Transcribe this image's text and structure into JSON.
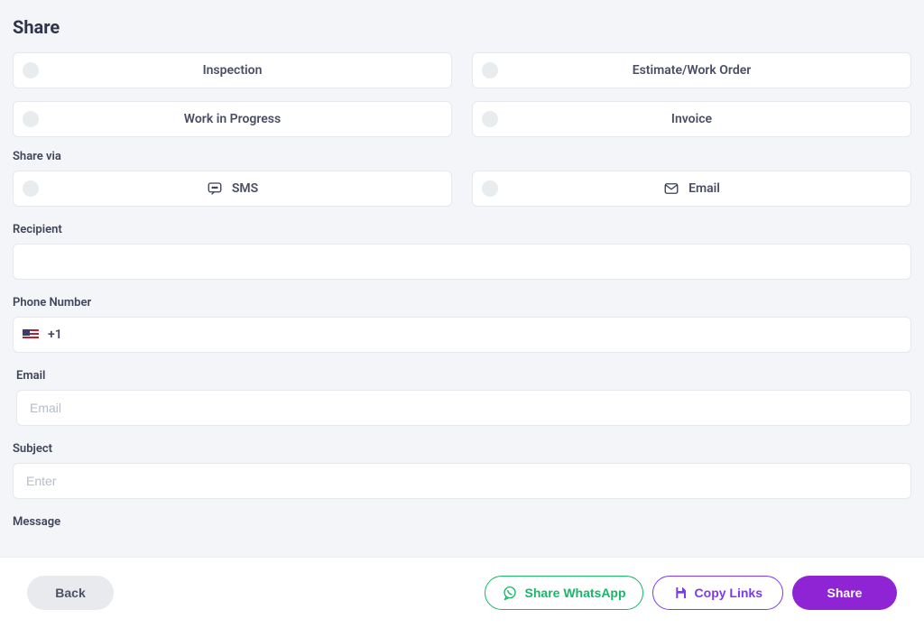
{
  "title": "Share",
  "doc_options": [
    {
      "id": "inspection",
      "label": "Inspection"
    },
    {
      "id": "estimate",
      "label": "Estimate/Work Order"
    },
    {
      "id": "wip",
      "label": "Work in Progress"
    },
    {
      "id": "invoice",
      "label": "Invoice"
    }
  ],
  "share_via": {
    "label": "Share via",
    "options": [
      {
        "id": "sms",
        "label": "SMS",
        "icon": "sms-icon"
      },
      {
        "id": "email",
        "label": "Email",
        "icon": "mail-icon"
      }
    ]
  },
  "fields": {
    "recipient": {
      "label": "Recipient",
      "value": ""
    },
    "phone": {
      "label": "Phone Number",
      "prefix": "+1",
      "value": ""
    },
    "email": {
      "label": "Email",
      "placeholder": "Email",
      "value": ""
    },
    "subject": {
      "label": "Subject",
      "placeholder": "Enter",
      "value": ""
    },
    "message": {
      "label": "Message",
      "value": ""
    }
  },
  "footer": {
    "back": "Back",
    "whatsapp": "Share WhatsApp",
    "copy": "Copy Links",
    "share": "Share"
  },
  "colors": {
    "accent_purple": "#8e24d4",
    "outline_purple": "#7c3aed",
    "whatsapp_green": "#18b667"
  }
}
